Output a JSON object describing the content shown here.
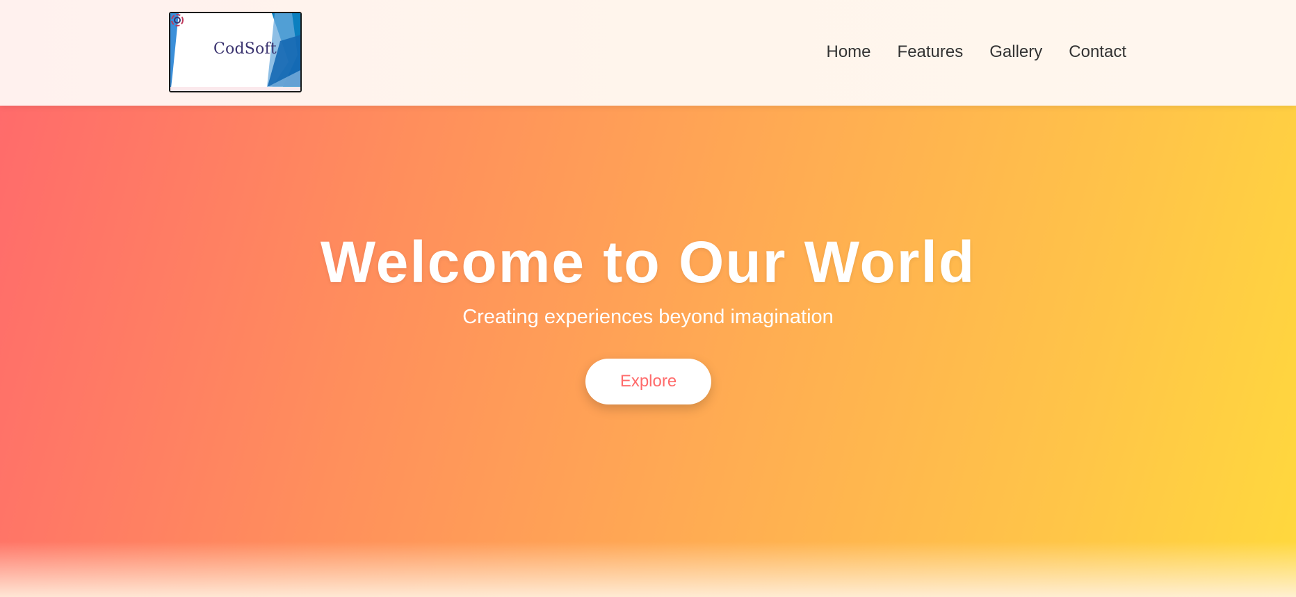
{
  "header": {
    "logo": {
      "text": "CodSoft",
      "icon": "codsoft-logo-mark"
    },
    "nav": [
      {
        "label": "Home"
      },
      {
        "label": "Features"
      },
      {
        "label": "Gallery"
      },
      {
        "label": "Contact"
      }
    ]
  },
  "hero": {
    "title": "Welcome to Our World",
    "subtitle": "Creating experiences beyond imagination",
    "cta_label": "Explore"
  },
  "colors": {
    "gradient_start": "#ff6b6b",
    "gradient_end": "#ffd93d",
    "cta_text": "#ff6b6b",
    "nav_text": "#333333"
  }
}
